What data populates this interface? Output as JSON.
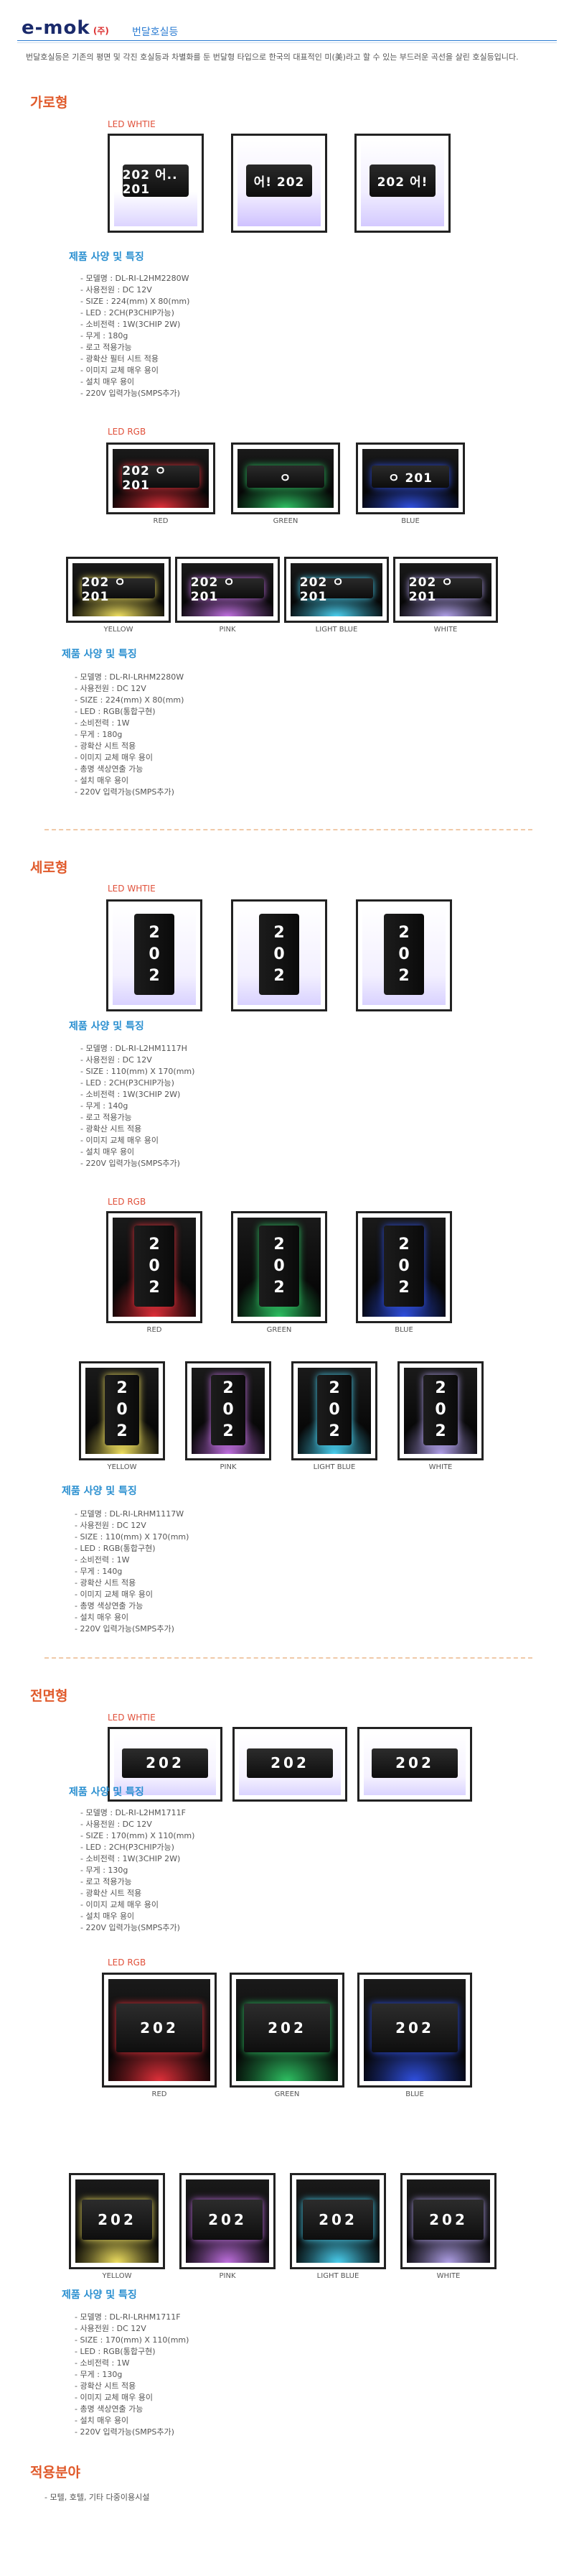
{
  "header": {
    "logo": "e-mok",
    "logo_sub": "(주)",
    "title": "번달호실등",
    "intro": "번달호실등은 기존의 평면 및 각진 호실등과 차별화를 둔 번달형 타입으로 한국의 대표적인 미(美)라고 할 수 있는 부드러운 곡선을 살린 호실등입니다."
  },
  "colors": {
    "accent_orange": "#e05a2b",
    "accent_blue": "#2a8fd0",
    "header_blue": "#2a7bd2"
  },
  "sections": {
    "garo": {
      "title": "가로형",
      "white_label": "LED WHTIE",
      "white_signs": [
        "202 어.. 201",
        "어! 202",
        "202 어!"
      ],
      "spec1_title": "제품 사양 및 특징",
      "spec1": [
        "- 모델명 : DL-RI-L2HM2280W",
        "- 사용전원 : DC 12V",
        "- SIZE : 224(mm) X 80(mm)",
        "- LED : 2CH(P3CHIP가능)",
        "- 소비전력 : 1W(3CHIP 2W)",
        "- 무게 : 180g",
        "- 로고 적용가능",
        "- 광확산 필터 시트 적용",
        "- 이미지 교체 매우 용이",
        "- 설치 매우 용이",
        "- 220V 입력가능(SMPS추가)"
      ],
      "rgb_label": "LED RGB",
      "rgb_top": [
        {
          "caption": "RED",
          "sign": "202 ㅇ 201",
          "glow": "#e0303a"
        },
        {
          "caption": "GREEN",
          "sign": "ㅇ",
          "glow": "#2ec062"
        },
        {
          "caption": "BLUE",
          "sign": "ㅇ 201",
          "glow": "#3050e0"
        }
      ],
      "rgb_bottom": [
        {
          "caption": "YELLOW",
          "sign": "202 ㅇ 201",
          "glow": "#f0e060"
        },
        {
          "caption": "PINK",
          "sign": "202 ㅇ 201",
          "glow": "#c070e0"
        },
        {
          "caption": "LIGHT BLUE",
          "sign": "202 ㅇ 201",
          "glow": "#4ad0f0"
        },
        {
          "caption": "WHITE",
          "sign": "202 ㅇ 201",
          "glow": "#b0a0e8"
        }
      ],
      "spec2_title": "제품 사양 및 특징",
      "spec2": [
        "- 모델명 : DL-RI-LRHM2280W",
        "- 사용전원 : DC 12V",
        "- SIZE : 224(mm) X 80(mm)",
        "- LED : RGB(통합구현)",
        "- 소비전력 : 1W",
        "- 무게 : 180g",
        "- 광확산 시트 적용",
        "- 이미지 교체 매우 용이",
        "- 총명 색상연출 가능",
        "- 설치 매우 용이",
        "- 220V 입력가능(SMPS추가)"
      ]
    },
    "sero": {
      "title": "세로형",
      "white_label": "LED WHTIE",
      "spec1_title": "제품 사양 및 특징",
      "spec1": [
        "- 모델명 : DL-RI-L2HM1117H",
        "- 사용전원 : DC 12V",
        "- SIZE : 110(mm) X 170(mm)",
        "- LED : 2CH(P3CHIP가능)",
        "- 소비전력 : 1W(3CHIP 2W)",
        "- 무게 : 140g",
        "- 로고 적용가능",
        "- 광확산 시트 적용",
        "- 이미지 교체 매우 용이",
        "- 설치 매우 용이",
        "- 220V 입력가능(SMPS추가)"
      ],
      "rgb_label": "LED RGB",
      "rgb_top": [
        {
          "caption": "RED",
          "glow": "#e0303a"
        },
        {
          "caption": "GREEN",
          "glow": "#2ec062"
        },
        {
          "caption": "BLUE",
          "glow": "#3050e0"
        }
      ],
      "rgb_bottom": [
        {
          "caption": "YELLOW",
          "glow": "#f0e060"
        },
        {
          "caption": "PINK",
          "glow": "#c070e0"
        },
        {
          "caption": "LIGHT BLUE",
          "glow": "#4ad0f0"
        },
        {
          "caption": "WHITE",
          "glow": "#b0a0e8"
        }
      ],
      "digits": "2 0 2",
      "spec2_title": "제품 사양 및 특징",
      "spec2": [
        "- 모델명 : DL-RI-LRHM1117W",
        "- 사용전원 : DC 12V",
        "- SIZE : 110(mm) X 170(mm)",
        "- LED : RGB(통합구현)",
        "- 소비전력 : 1W",
        "- 무게 : 140g",
        "- 광확산 시트 적용",
        "- 이미지 교체 매우 용이",
        "- 총명 색상연출 가능",
        "- 설치 매우 용이",
        "- 220V 입력가능(SMPS추가)"
      ]
    },
    "jeonmyeon": {
      "title": "전면형",
      "white_label": "LED WHTIE",
      "number": "202",
      "spec1_title": "제품 사양 및 특징",
      "spec1": [
        "- 모델명 : DL-RI-L2HM1711F",
        "- 사용전원 : DC 12V",
        "- SIZE : 170(mm) X 110(mm)",
        "- LED : 2CH(P3CHIP가능)",
        "- 소비전력 : 1W(3CHIP 2W)",
        "- 무게 : 130g",
        "- 로고 적용가능",
        "- 광확산 시트 적용",
        "- 이미지 교체 매우 용이",
        "- 설치 매우 용이",
        "- 220V 입력가능(SMPS추가)"
      ],
      "rgb_label": "LED RGB",
      "rgb_top": [
        {
          "caption": "RED",
          "glow": "#e0303a"
        },
        {
          "caption": "GREEN",
          "glow": "#2ec062"
        },
        {
          "caption": "BLUE",
          "glow": "#3050e0"
        }
      ],
      "rgb_bottom": [
        {
          "caption": "YELLOW",
          "glow": "#f0e060"
        },
        {
          "caption": "PINK",
          "glow": "#c070e0"
        },
        {
          "caption": "LIGHT BLUE",
          "glow": "#4ad0f0"
        },
        {
          "caption": "WHITE",
          "glow": "#b0a0e8"
        }
      ],
      "spec2_title": "제품 사양 및 특징",
      "spec2": [
        "- 모델명 : DL-RI-LRHM1711F",
        "- 사용전원 : DC 12V",
        "- SIZE : 170(mm) X 110(mm)",
        "- LED : RGB(통합구현)",
        "- 소비전력 : 1W",
        "- 무게 : 130g",
        "- 광확산 시트 적용",
        "- 이미지 교체 매우 용이",
        "- 총명 색상연출 가능",
        "- 설치 매우 용이",
        "- 220V 입력가능(SMPS추가)"
      ]
    }
  },
  "applications": {
    "title": "적용분야",
    "text": "- 모텔, 호텔, 기타 다중이용시설"
  }
}
